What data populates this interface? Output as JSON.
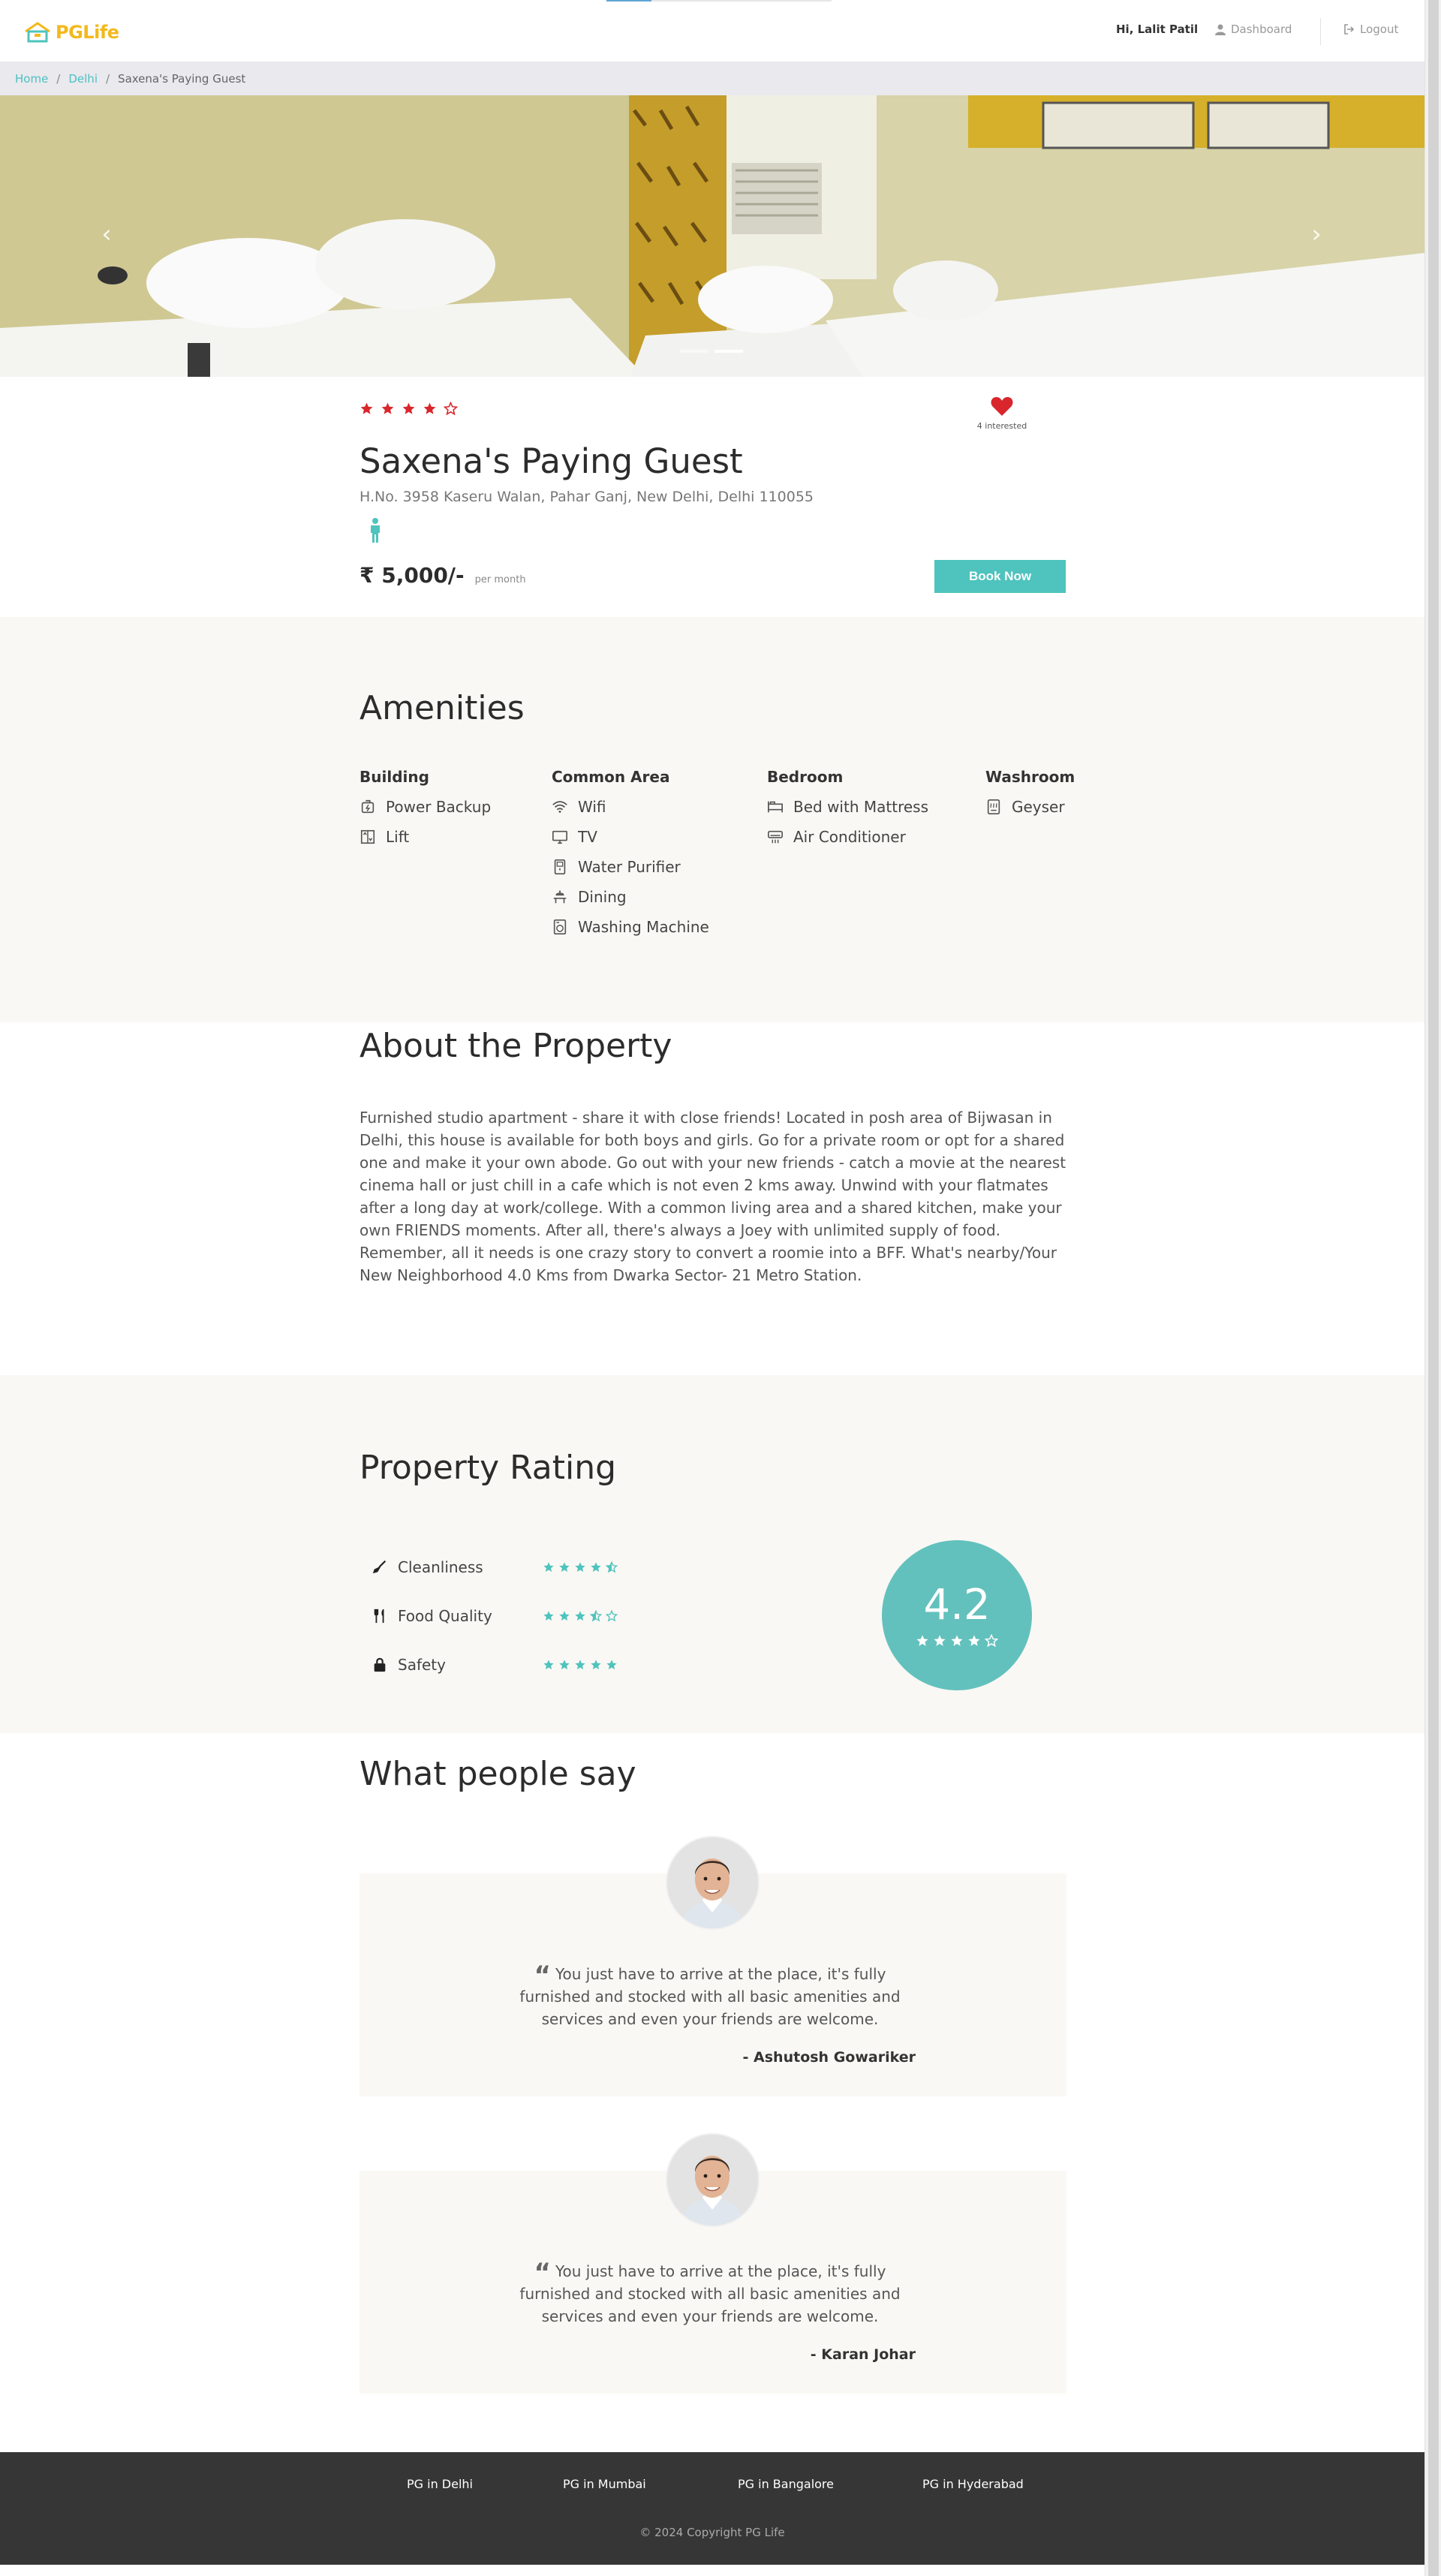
{
  "header": {
    "logo_text_1": "PG",
    "logo_text_2": "Life",
    "greeting": "Hi, Lalit Patil",
    "dashboard_label": "Dashboard",
    "logout_label": "Logout"
  },
  "breadcrumb": {
    "items": [
      "Home",
      "Delhi"
    ],
    "separator": "/",
    "current": "Saxena's Paying Guest"
  },
  "property": {
    "rating_stars": 4,
    "interested_count": "4 interested",
    "name": "Saxena's Paying Guest",
    "address": "H.No. 3958 Kaseru Walan, Pahar Ganj, New Delhi, Delhi 110055",
    "gender_icon": "male-icon",
    "rent": "₹ 5,000/-",
    "rent_unit": "per month",
    "book_button": "Book Now"
  },
  "amenities": {
    "title": "Amenities",
    "groups": [
      {
        "heading": "Building",
        "items": [
          {
            "label": "Power Backup",
            "icon": "power-backup-icon"
          },
          {
            "label": "Lift",
            "icon": "lift-icon"
          }
        ]
      },
      {
        "heading": "Common Area",
        "items": [
          {
            "label": "Wifi",
            "icon": "wifi-icon"
          },
          {
            "label": "TV",
            "icon": "tv-icon"
          },
          {
            "label": "Water Purifier",
            "icon": "water-purifier-icon"
          },
          {
            "label": "Dining",
            "icon": "dining-icon"
          },
          {
            "label": "Washing Machine",
            "icon": "washing-machine-icon"
          }
        ]
      },
      {
        "heading": "Bedroom",
        "items": [
          {
            "label": "Bed with Mattress",
            "icon": "bed-icon"
          },
          {
            "label": "Air Conditioner",
            "icon": "air-conditioner-icon"
          }
        ]
      },
      {
        "heading": "Washroom",
        "items": [
          {
            "label": "Geyser",
            "icon": "geyser-icon"
          }
        ]
      }
    ]
  },
  "about": {
    "title": "About the Property",
    "text": "Furnished studio apartment - share it with close friends! Located in posh area of Bijwasan in Delhi, this house is available for both boys and girls. Go for a private room or opt for a shared one and make it your own abode. Go out with your new friends - catch a movie at the nearest cinema hall or just chill in a cafe which is not even 2 kms away. Unwind with your flatmates after a long day at work/college. With a common living area and a shared kitchen, make your own FRIENDS moments. After all, there's always a Joey with unlimited supply of food. Remember, all it needs is one crazy story to convert a roomie into a BFF. What's nearby/Your New Neighborhood 4.0 Kms from Dwarka Sector- 21 Metro Station."
  },
  "rating": {
    "title": "Property Rating",
    "criteria": [
      {
        "label": "Cleanliness",
        "stars": 4.5,
        "icon": "broom-icon"
      },
      {
        "label": "Food Quality",
        "stars": 3.5,
        "icon": "utensils-icon"
      },
      {
        "label": "Safety",
        "stars": 5,
        "icon": "lock-icon"
      }
    ],
    "overall": "4.2",
    "overall_stars": 4
  },
  "testimonials": {
    "title": "What people say",
    "items": [
      {
        "text": "You just have to arrive at the place, it's fully furnished and stocked with all basic amenities and services and even your friends are welcome.",
        "author": "- Ashutosh Gowariker"
      },
      {
        "text": "You just have to arrive at the place, it's fully furnished and stocked with all basic amenities and services and even your friends are welcome.",
        "author": "- Karan Johar"
      }
    ]
  },
  "footer": {
    "links": [
      "PG in Delhi",
      "PG in Mumbai",
      "PG in Bangalore",
      "PG in Hyderabad"
    ],
    "copyright": "© 2024 Copyright PG Life"
  },
  "colors": {
    "accent": "#4fc3bd",
    "star_red": "#d9262c",
    "star_teal": "#4fc3bd",
    "section_bg": "#f9f8f4",
    "footer_bg": "#363636",
    "logo_yellow": "#f2b91c"
  }
}
